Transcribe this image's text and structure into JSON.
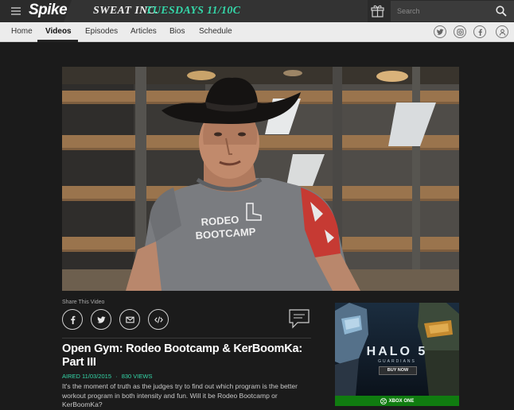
{
  "brand": {
    "logo_text": "Spike"
  },
  "promo": {
    "show": "SWEAT",
    "show_suffix": "INC.",
    "schedule": "TUESDAYS 11/10C"
  },
  "search": {
    "placeholder": "Search"
  },
  "nav": {
    "items": [
      {
        "label": "Home",
        "active": false
      },
      {
        "label": "Videos",
        "active": true
      },
      {
        "label": "Episodes",
        "active": false
      },
      {
        "label": "Articles",
        "active": false
      },
      {
        "label": "Bios",
        "active": false
      },
      {
        "label": "Schedule",
        "active": false
      }
    ],
    "social_icons": [
      "twitter-icon",
      "instagram-icon",
      "facebook-icon",
      "user-icon"
    ]
  },
  "video": {
    "shirt_line1": "RODEO",
    "shirt_line2": "BOOTCAMP"
  },
  "share": {
    "label": "Share This Video",
    "buttons": [
      "facebook-icon",
      "twitter-icon",
      "email-icon",
      "embed-code-icon"
    ]
  },
  "article": {
    "title": "Open Gym: Rodeo Bootcamp & KerBoomKa: Part III",
    "aired": "AIRED 11/03/2015",
    "separator": "·",
    "views": "830 VIEWS",
    "description": "It's the moment of truth as the judges try to find out which program is the better workout program in both intensity and fun. Will it be Rodeo Bootcamp or KerBoomKa?"
  },
  "ad": {
    "title": "HALO 5",
    "subtitle": "GUARDIANS",
    "buy_label": "BUY NOW",
    "footer": "XBOX ONE"
  },
  "colors": {
    "accent": "#34d6a8",
    "xbox_green": "#107c10",
    "topbar": "#2b2b2b",
    "navbar": "#ececec"
  }
}
